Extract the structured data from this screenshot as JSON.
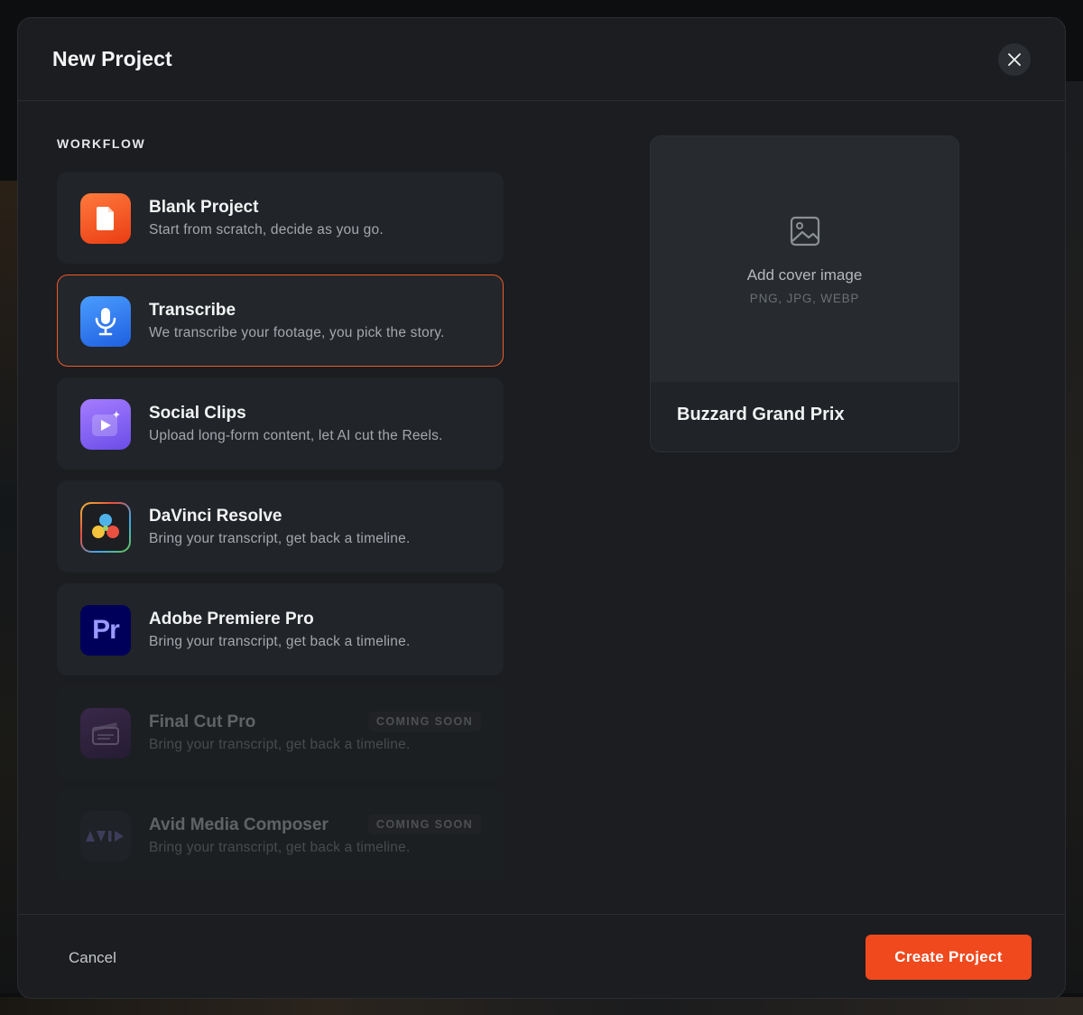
{
  "modal": {
    "title": "New Project",
    "section_label": "WORKFLOW"
  },
  "workflows": [
    {
      "title": "Blank Project",
      "description": "Start from scratch, decide as you go.",
      "icon": "blank-document-icon",
      "color": "#f0571f",
      "selected": false,
      "disabled": false
    },
    {
      "title": "Transcribe",
      "description": "We transcribe your footage, you pick the story.",
      "icon": "microphone-icon",
      "color": "#2f7cf0",
      "selected": true,
      "disabled": false
    },
    {
      "title": "Social Clips",
      "description": "Upload long-form content, let AI cut the Reels.",
      "icon": "play-sparkle-icon",
      "color": "#8b5cf6",
      "selected": false,
      "disabled": false
    },
    {
      "title": "DaVinci Resolve",
      "description": "Bring your transcript, get back a timeline.",
      "icon": "davinci-resolve-icon",
      "color": "#1e2024",
      "selected": false,
      "disabled": false
    },
    {
      "title": "Adobe Premiere Pro",
      "description": "Bring your transcript, get back a timeline.",
      "icon": "premiere-pro-icon",
      "color": "#00005b",
      "selected": false,
      "disabled": false
    },
    {
      "title": "Final Cut Pro",
      "description": "Bring your transcript, get back a timeline.",
      "icon": "final-cut-pro-icon",
      "color": "#5b2a7a",
      "badge": "COMING SOON",
      "selected": false,
      "disabled": true
    },
    {
      "title": "Avid Media Composer",
      "description": "Bring your transcript, get back a timeline.",
      "icon": "avid-icon",
      "color": "#2a2d31",
      "badge": "COMING SOON",
      "selected": false,
      "disabled": true
    }
  ],
  "cover": {
    "label": "Add cover image",
    "formats": "PNG, JPG, WEBP",
    "project_name": "Buzzard Grand Prix"
  },
  "footer": {
    "cancel_label": "Cancel",
    "create_label": "Create Project"
  },
  "colors": {
    "accent": "#f0491e",
    "selected_border": "#ef5a2a"
  }
}
